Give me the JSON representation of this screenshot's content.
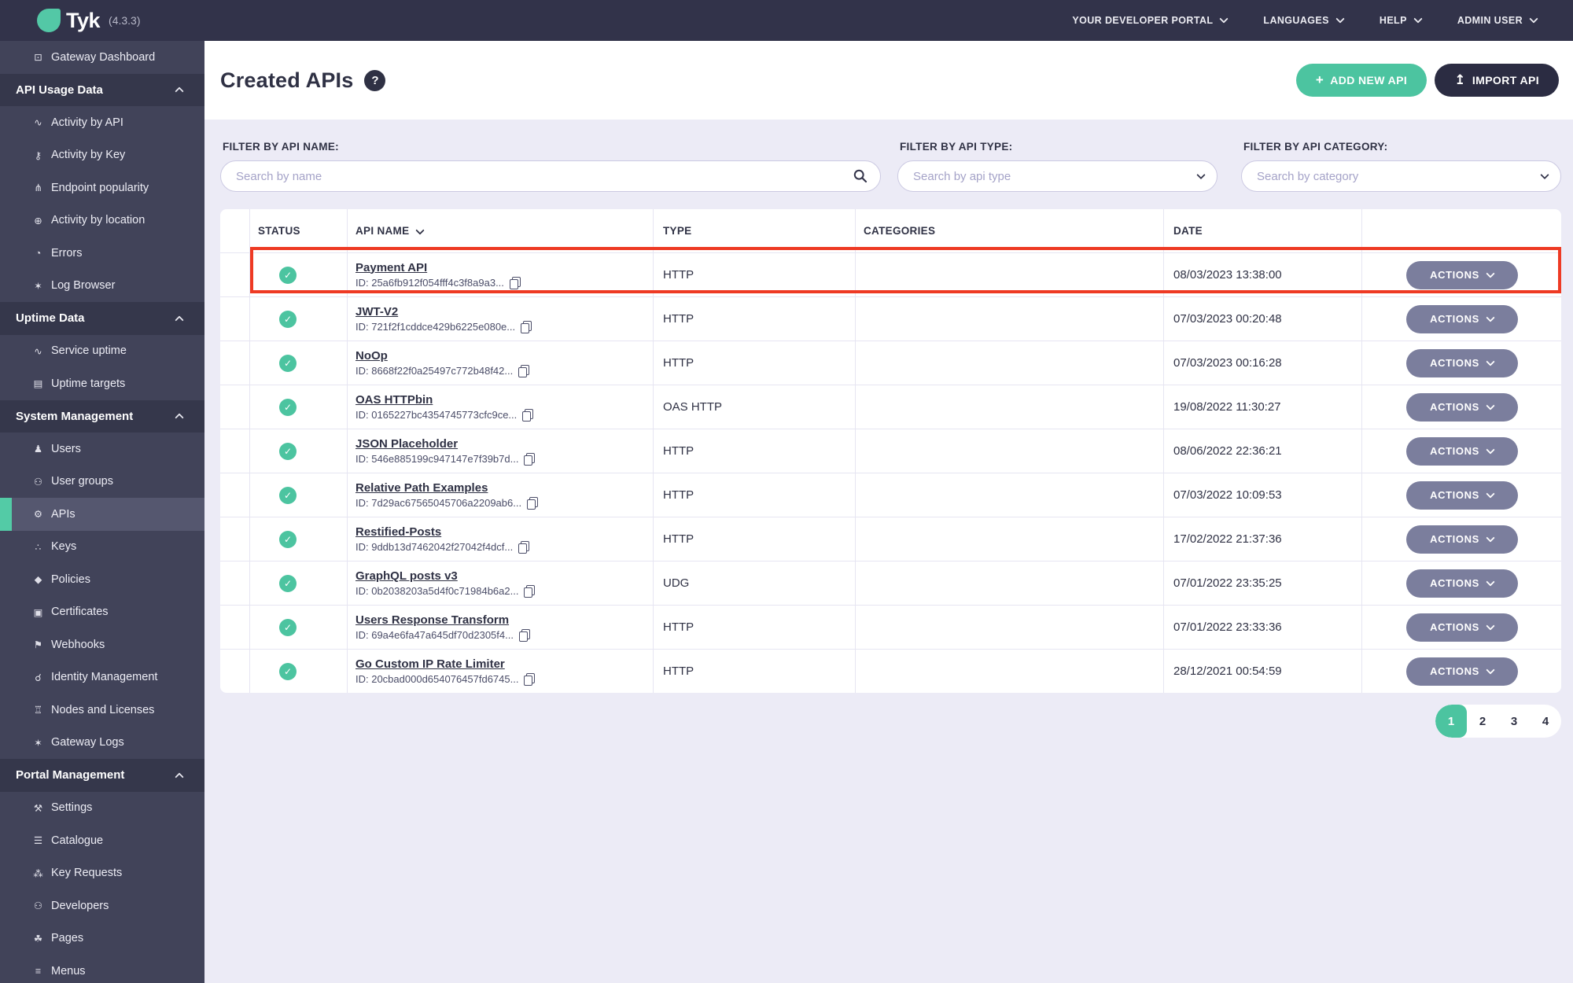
{
  "topbar": {
    "brand": "Tyk",
    "version": "(4.3.3)",
    "menu": [
      {
        "label": "YOUR DEVELOPER PORTAL"
      },
      {
        "label": "LANGUAGES"
      },
      {
        "label": "HELP"
      },
      {
        "label": "ADMIN USER"
      }
    ]
  },
  "sidebar": {
    "items": [
      {
        "type": "link",
        "label": "Gateway Dashboard",
        "icon": "monitor-icon",
        "glyph": "⊡"
      },
      {
        "type": "section",
        "label": "API Usage Data"
      },
      {
        "type": "link",
        "label": "Activity by API",
        "icon": "activity-chart-icon",
        "glyph": "∿"
      },
      {
        "type": "link",
        "label": "Activity by Key",
        "icon": "key-icon",
        "glyph": "⚷"
      },
      {
        "type": "link",
        "label": "Endpoint popularity",
        "icon": "branch-icon",
        "glyph": "⋔"
      },
      {
        "type": "link",
        "label": "Activity by location",
        "icon": "globe-icon",
        "glyph": "⊕"
      },
      {
        "type": "link",
        "label": "Errors",
        "icon": "errors-icon",
        "glyph": "◔"
      },
      {
        "type": "link",
        "label": "Log Browser",
        "icon": "bug-icon",
        "glyph": "✶"
      },
      {
        "type": "section",
        "label": "Uptime Data"
      },
      {
        "type": "link",
        "label": "Service uptime",
        "icon": "uptime-chart-icon",
        "glyph": "∿"
      },
      {
        "type": "link",
        "label": "Uptime targets",
        "icon": "list-grid-icon",
        "glyph": "▤"
      },
      {
        "type": "section",
        "label": "System Management"
      },
      {
        "type": "link",
        "label": "Users",
        "icon": "user-icon",
        "glyph": "♟"
      },
      {
        "type": "link",
        "label": "User groups",
        "icon": "user-group-icon",
        "glyph": "⚇"
      },
      {
        "type": "link",
        "label": "APIs",
        "icon": "gears-icon",
        "glyph": "⚙",
        "active": true
      },
      {
        "type": "link",
        "label": "Keys",
        "icon": "sitemap-icon",
        "glyph": "∴"
      },
      {
        "type": "link",
        "label": "Policies",
        "icon": "shield-icon",
        "glyph": "◆"
      },
      {
        "type": "link",
        "label": "Certificates",
        "icon": "certificate-icon",
        "glyph": "▣"
      },
      {
        "type": "link",
        "label": "Webhooks",
        "icon": "bell-icon",
        "glyph": "⚑"
      },
      {
        "type": "link",
        "label": "Identity Management",
        "icon": "plug-icon",
        "glyph": "☌"
      },
      {
        "type": "link",
        "label": "Nodes and Licenses",
        "icon": "bank-icon",
        "glyph": "♖"
      },
      {
        "type": "link",
        "label": "Gateway Logs",
        "icon": "bug-icon",
        "glyph": "✶"
      },
      {
        "type": "section",
        "label": "Portal Management"
      },
      {
        "type": "link",
        "label": "Settings",
        "icon": "wrench-icon",
        "glyph": "⚒"
      },
      {
        "type": "link",
        "label": "Catalogue",
        "icon": "catalogue-icon",
        "glyph": "☰"
      },
      {
        "type": "link",
        "label": "Key Requests",
        "icon": "paw-icon",
        "glyph": "⁂"
      },
      {
        "type": "link",
        "label": "Developers",
        "icon": "developers-icon",
        "glyph": "⚇"
      },
      {
        "type": "link",
        "label": "Pages",
        "icon": "leaf-icon",
        "glyph": "☘"
      },
      {
        "type": "link",
        "label": "Menus",
        "icon": "menu-icon",
        "glyph": "≡"
      }
    ]
  },
  "page": {
    "title": "Created APIs",
    "help_glyph": "?",
    "buttons": {
      "add": "ADD NEW API",
      "add_glyph": "+",
      "import": "IMPORT API",
      "import_glyph": "↥"
    }
  },
  "filters": [
    {
      "label": "FILTER BY API NAME:",
      "placeholder": "Search by name",
      "kind": "search"
    },
    {
      "label": "FILTER BY API TYPE:",
      "placeholder": "Search by api type",
      "kind": "select"
    },
    {
      "label": "FILTER BY API CATEGORY:",
      "placeholder": "Search by category",
      "kind": "select"
    }
  ],
  "table": {
    "status_glyph": "✓",
    "headers": [
      {
        "label": ""
      },
      {
        "label": "STATUS"
      },
      {
        "label": "API NAME",
        "sortable": true
      },
      {
        "label": "TYPE"
      },
      {
        "label": "CATEGORIES"
      },
      {
        "label": "DATE"
      },
      {
        "label": ""
      }
    ],
    "actions_label": "ACTIONS",
    "rows": [
      {
        "status": "active",
        "name": "Payment API",
        "id": "ID: 25a6fb912f054fff4c3f8a9a3...",
        "type": "HTTP",
        "categories": "",
        "date": "08/03/2023 13:38:00",
        "highlighted": true
      },
      {
        "status": "active",
        "name": "JWT-V2",
        "id": "ID: 721f2f1cddce429b6225e080e...",
        "type": "HTTP",
        "categories": "",
        "date": "07/03/2023 00:20:48"
      },
      {
        "status": "active",
        "name": "NoOp",
        "id": "ID: 8668f22f0a25497c772b48f42...",
        "type": "HTTP",
        "categories": "",
        "date": "07/03/2023 00:16:28"
      },
      {
        "status": "active",
        "name": "OAS HTTPbin",
        "id": "ID: 0165227bc4354745773cfc9ce...",
        "type": "OAS HTTP",
        "categories": "",
        "date": "19/08/2022 11:30:27"
      },
      {
        "status": "active",
        "name": "JSON Placeholder",
        "id": "ID: 546e885199c947147e7f39b7d...",
        "type": "HTTP",
        "categories": "",
        "date": "08/06/2022 22:36:21"
      },
      {
        "status": "active",
        "name": "Relative Path Examples",
        "id": "ID: 7d29ac67565045706a2209ab6...",
        "type": "HTTP",
        "categories": "",
        "date": "07/03/2022 10:09:53"
      },
      {
        "status": "active",
        "name": "Restified-Posts",
        "id": "ID: 9ddb13d7462042f27042f4dcf...",
        "type": "HTTP",
        "categories": "",
        "date": "17/02/2022 21:37:36"
      },
      {
        "status": "active",
        "name": "GraphQL posts v3",
        "id": "ID: 0b2038203a5d4f0c71984b6a2...",
        "type": "UDG",
        "categories": "",
        "date": "07/01/2022 23:35:25"
      },
      {
        "status": "active",
        "name": "Users Response Transform",
        "id": "ID: 69a4e6fa47a645df70d2305f4...",
        "type": "HTTP",
        "categories": "",
        "date": "07/01/2022 23:33:36"
      },
      {
        "status": "active",
        "name": "Go Custom IP Rate Limiter",
        "id": "ID: 20cbad000d654076457fd6745...",
        "type": "HTTP",
        "categories": "",
        "date": "28/12/2021 00:54:59"
      }
    ]
  },
  "pagination": {
    "pages": [
      "1",
      "2",
      "3",
      "4"
    ],
    "active": "1"
  },
  "colors": {
    "accent_teal": "#4CC4A0",
    "dark_navy": "#32334A",
    "sidebar_bg": "#414359",
    "sidebar_section_bg": "#35374B",
    "panel_lavender": "#ECEBF6",
    "actions_gray": "#7B7E9D",
    "highlight_red": "#EE3A24"
  }
}
